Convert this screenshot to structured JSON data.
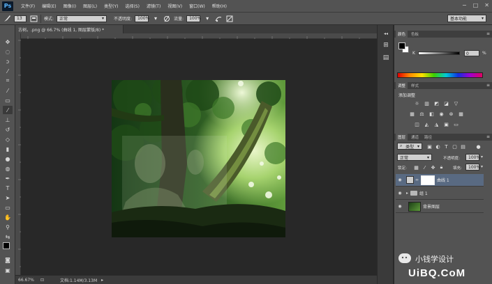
{
  "app": {
    "logo": "Ps"
  },
  "menu": [
    "文件(F)",
    "编辑(E)",
    "图像(I)",
    "图层(L)",
    "类型(Y)",
    "选择(S)",
    "滤镜(T)",
    "视图(V)",
    "窗口(W)",
    "帮助(H)"
  ],
  "window_controls": [
    "−",
    "□",
    "✕"
  ],
  "options": {
    "brush_size": "13",
    "mode_label": "模式:",
    "mode_value": "正常",
    "opacity_label": "不透明度:",
    "opacity_value": "100%",
    "flow_label": "流量:",
    "flow_value": "100%",
    "workspace": "基本功能"
  },
  "document": {
    "tab_title": "古树。.png @ 66.7% (曲线 1, 图层蒙版/8) *",
    "zoom": "66.67%",
    "file_info": "文档:1.14M/3.13M"
  },
  "panels": {
    "color": {
      "tabs": [
        "颜色",
        "色板"
      ],
      "k_label": "K",
      "k_value": "0",
      "unit": "%"
    },
    "adjustments": {
      "tabs": [
        "调整",
        "样式"
      ],
      "title": "添加调整"
    },
    "layers": {
      "tabs": [
        "图层",
        "通道",
        "路径"
      ],
      "filter": "类型",
      "blend": "正常",
      "opacity_label": "不透明度:",
      "opacity_value": "100%",
      "lock_label": "锁定:",
      "fill_label": "填充:",
      "fill_value": "100%",
      "items": [
        {
          "name": "曲线 1"
        },
        {
          "name": "组 1"
        },
        {
          "name": "背景图层"
        }
      ]
    }
  },
  "watermark": {
    "brand": "小钱学设计",
    "site": "UiBQ.CoM"
  },
  "colors": {
    "chrome": "#535353",
    "canvas_bg": "#282828",
    "selected_layer": "#596a82"
  }
}
